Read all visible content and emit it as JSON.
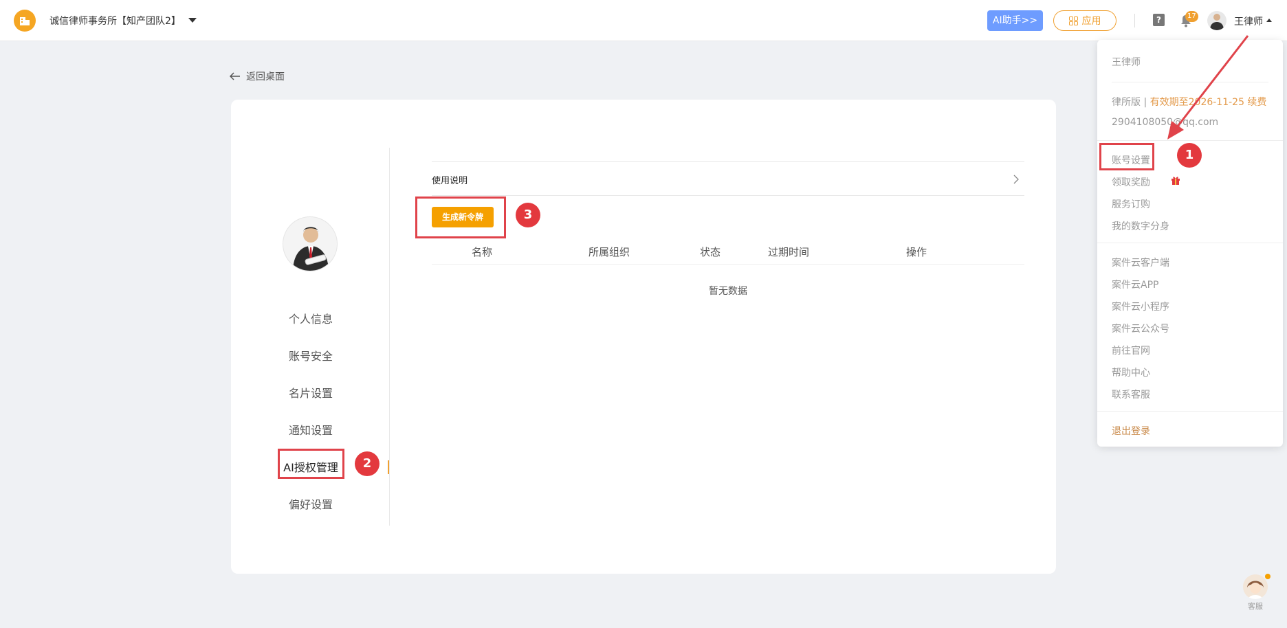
{
  "header": {
    "org_name": "诚信律师事务所【知产团队2】",
    "ai_button": "AI助手>>",
    "app_button": "应用",
    "help_icon_glyph": "?",
    "notification_count": "17",
    "user_name": "王律师",
    "accent_color": "#f5a623"
  },
  "back_link": "返回桌面",
  "sidebar": {
    "items": [
      {
        "label": "个人信息"
      },
      {
        "label": "账号安全"
      },
      {
        "label": "名片设置"
      },
      {
        "label": "通知设置"
      },
      {
        "label": "AI授权管理",
        "active": true
      },
      {
        "label": "偏好设置"
      }
    ]
  },
  "content": {
    "usage_label": "使用说明",
    "generate_button": "生成新令牌",
    "table_headers": [
      "名称",
      "所属组织",
      "状态",
      "过期时间",
      "操作"
    ],
    "empty_text": "暂无数据"
  },
  "annotations": {
    "badge_1": "1",
    "badge_2": "2",
    "badge_3": "3",
    "highlight_color": "#e0434a"
  },
  "dropdown": {
    "name": "王律师",
    "plan_prefix": "律所版 | ",
    "plan_expiry": "有效期至2026-11-25 续费",
    "email": "2904108050@qq.com",
    "group1": [
      "账号设置",
      "领取奖励",
      "服务订购",
      "我的数字分身"
    ],
    "group2": [
      "案件云客户端",
      "案件云APP",
      "案件云小程序",
      "案件云公众号",
      "前往官网",
      "帮助中心",
      "联系客服"
    ],
    "logout": "退出登录"
  },
  "customer_service_label": "客服"
}
